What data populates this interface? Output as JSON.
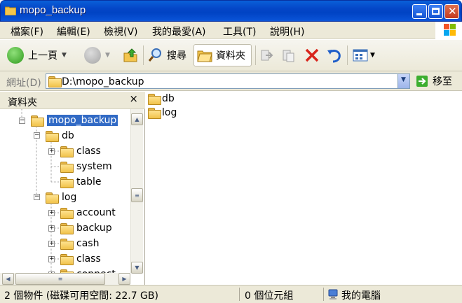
{
  "window": {
    "title": "mopo_backup"
  },
  "menu": {
    "file": "檔案(F)",
    "edit": "編輯(E)",
    "view": "檢視(V)",
    "favorites": "我的最愛(A)",
    "tools": "工具(T)",
    "help": "說明(H)"
  },
  "toolbar": {
    "back_label": "上一頁",
    "search_label": "搜尋",
    "folders_label": "資料夾"
  },
  "address": {
    "label": "網址(D)",
    "value": "D:\\mopo_backup",
    "go_label": "移至"
  },
  "folders_pane": {
    "title": "資料夾",
    "close": "×",
    "tree": [
      "mopo_backup",
      "db",
      "class",
      "system",
      "table",
      "log",
      "account",
      "backup",
      "cash",
      "class",
      "connect"
    ]
  },
  "files": [
    "db",
    "log"
  ],
  "status": {
    "objects": "2 個物件 (磁碟可用空間: 22.7 GB)",
    "size": "0 個位元組",
    "location": "我的電腦"
  },
  "colors": {
    "title_blue": "#0043c4",
    "selection": "#316ac5",
    "chrome": "#ece9d8"
  }
}
